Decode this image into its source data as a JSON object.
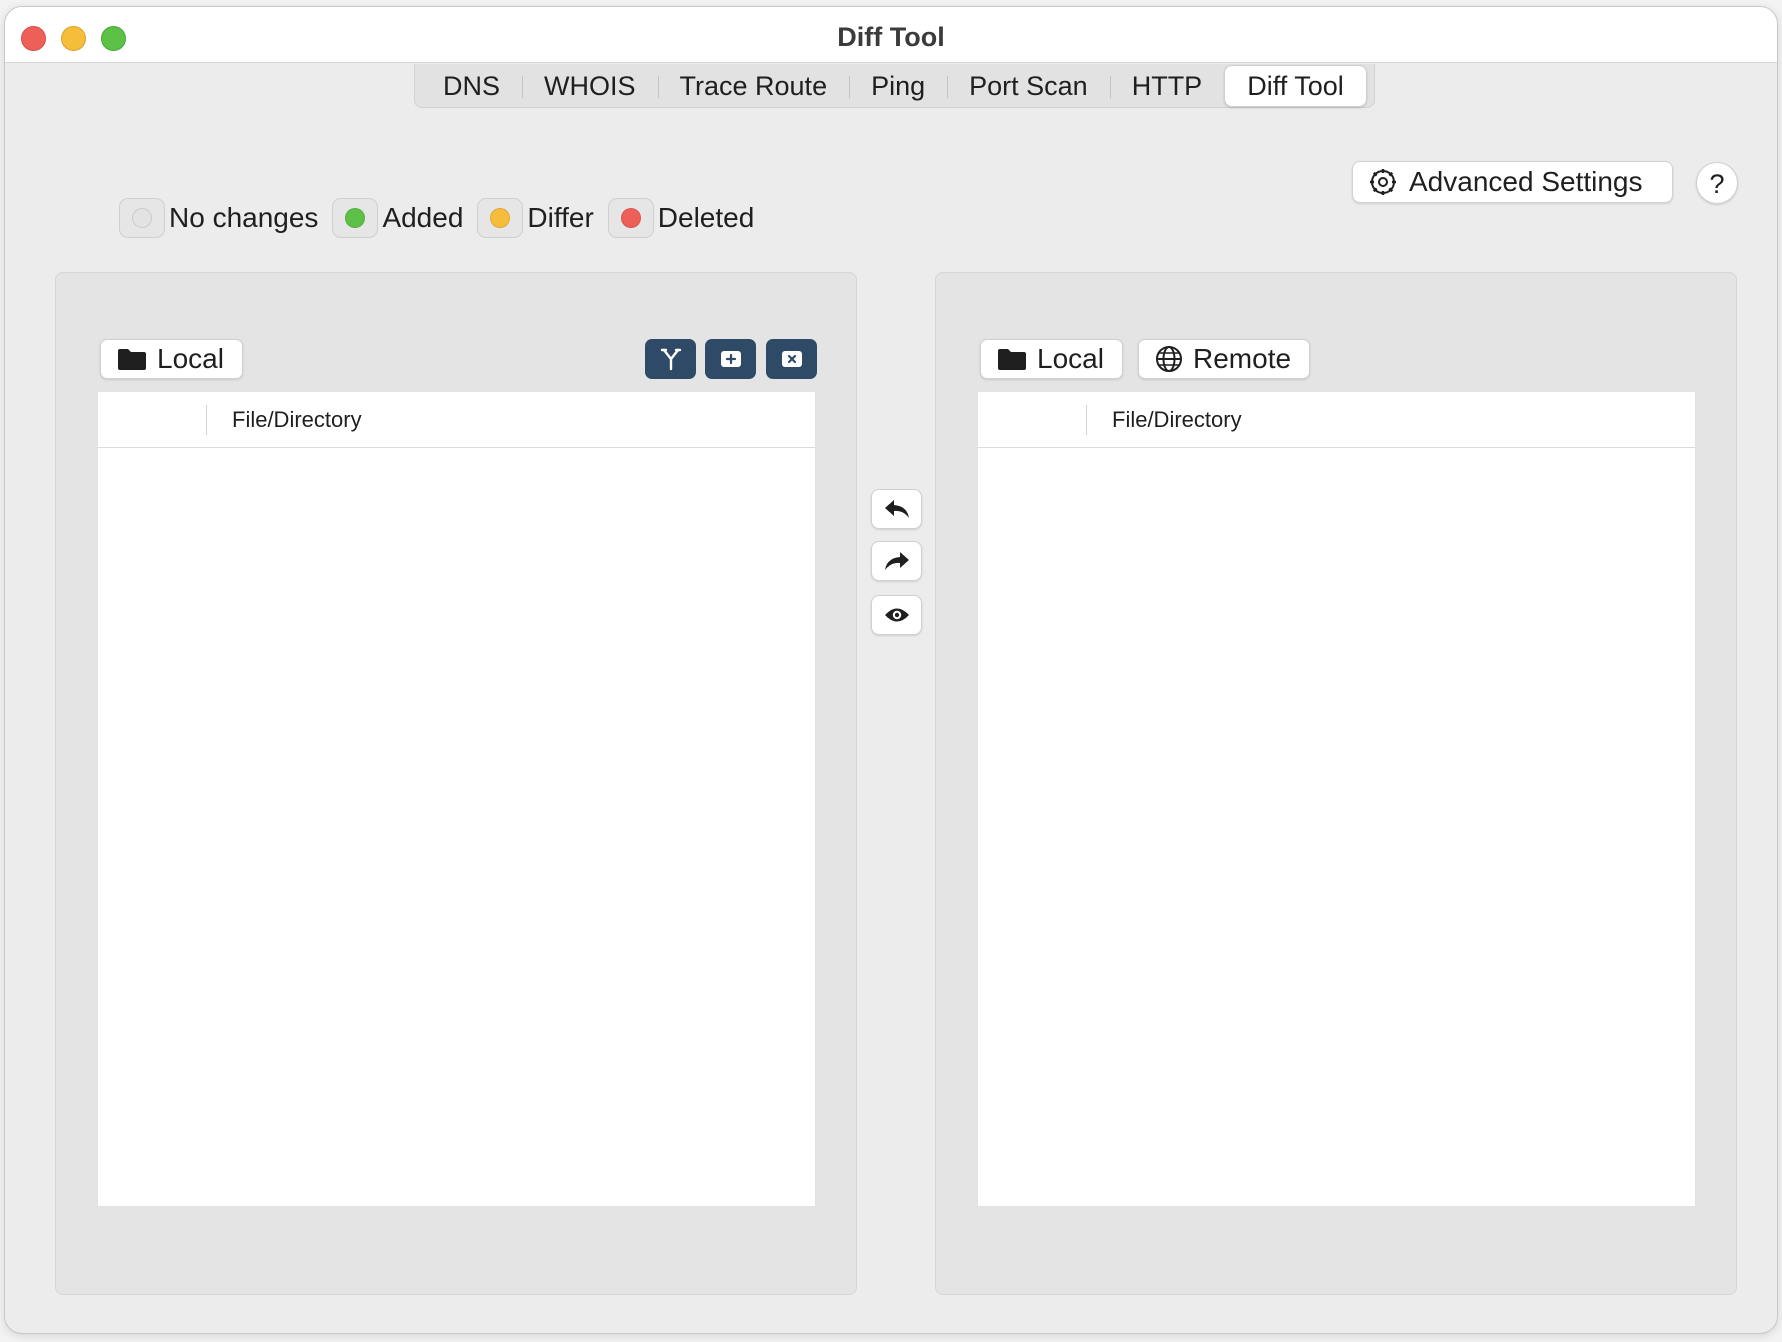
{
  "window": {
    "title": "Diff Tool"
  },
  "tabs": [
    {
      "label": "DNS",
      "active": false
    },
    {
      "label": "WHOIS",
      "active": false
    },
    {
      "label": "Trace Route",
      "active": false
    },
    {
      "label": "Ping",
      "active": false
    },
    {
      "label": "Port Scan",
      "active": false
    },
    {
      "label": "HTTP",
      "active": false
    },
    {
      "label": "Diff Tool",
      "active": true
    }
  ],
  "legend": [
    {
      "label": "No changes",
      "color": "#e3e3e3"
    },
    {
      "label": "Added",
      "color": "#5cc146"
    },
    {
      "label": "Differ",
      "color": "#f6bd3b"
    },
    {
      "label": "Deleted",
      "color": "#ee5f57"
    }
  ],
  "toolbar": {
    "advanced_settings_label": "Advanced Settings",
    "help_label": "?"
  },
  "left_panel": {
    "source_label": "Local",
    "column_header": "File/Directory",
    "tool_icons": [
      "merge-icon",
      "add-icon",
      "remove-icon"
    ]
  },
  "right_panel": {
    "local_label": "Local",
    "remote_label": "Remote",
    "column_header": "File/Directory"
  },
  "middle_actions": [
    "reply-icon",
    "share-icon",
    "eye-icon"
  ],
  "colors": {
    "tool_button": "#2e4a66",
    "window_bg": "#ececec"
  }
}
